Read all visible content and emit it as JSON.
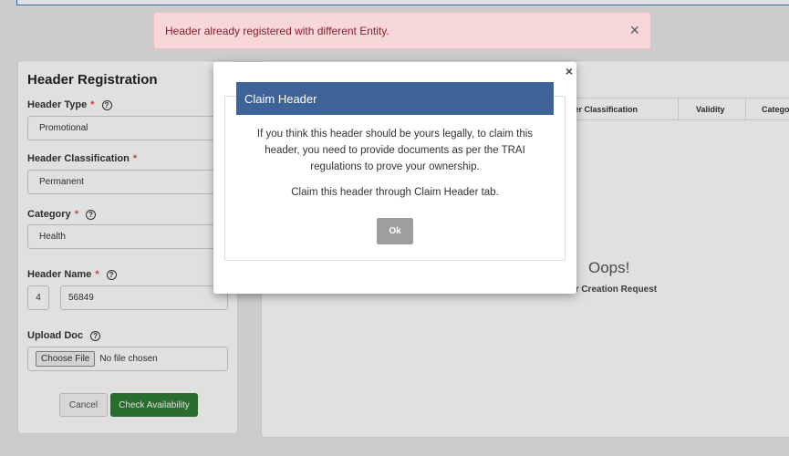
{
  "alert": {
    "message": "Header already registered with different Entity.",
    "close": "×"
  },
  "form": {
    "title": "Header Registration",
    "header_type": {
      "label": "Header Type",
      "required": "*",
      "value": "Promotional"
    },
    "header_classification": {
      "label": "Header Classification",
      "required": "*",
      "value": "Permanent"
    },
    "category": {
      "label": "Category",
      "required": "*",
      "value": "Health"
    },
    "header_name": {
      "label": "Header Name",
      "required": "*",
      "prefix": "4",
      "value": "56849"
    },
    "upload_doc": {
      "label": "Upload Doc",
      "choose_file": "Choose File",
      "file_status": "No file chosen"
    },
    "cancel_label": "Cancel",
    "check_label": "Check Availability",
    "help_glyph": "?"
  },
  "requests": {
    "columns": [
      "der Classification",
      "Validity",
      "Catego"
    ],
    "empty_title": "Oops!",
    "empty_sub": "der Creation Request"
  },
  "modal": {
    "close": "×",
    "title": "Claim Header",
    "body": "If you think this header should be yours legally, to claim this header, you need to provide documents as per the TRAI regulations to prove your ownership.",
    "body2": "Claim this header through Claim Header tab.",
    "ok_label": "Ok"
  },
  "colors": {
    "alert_bg": "#f8d7da",
    "modal_header": "#3d6399",
    "check_button": "#2e7d32"
  }
}
